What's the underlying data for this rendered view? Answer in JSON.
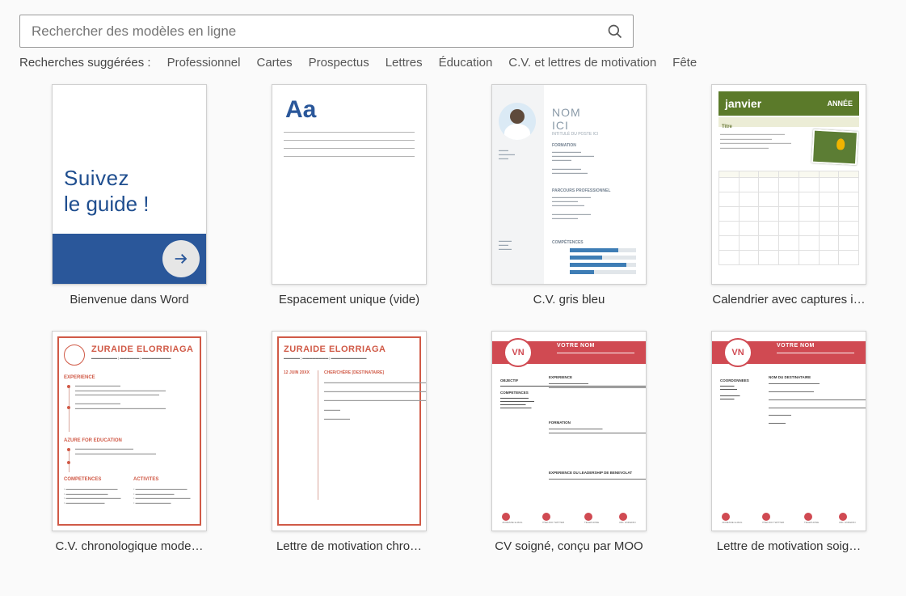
{
  "search": {
    "placeholder": "Rechercher des modèles en ligne"
  },
  "suggestions": {
    "label": "Recherches suggérées :",
    "items": [
      "Professionnel",
      "Cartes",
      "Prospectus",
      "Lettres",
      "Éducation",
      "C.V. et lettres de motivation",
      "Fête"
    ]
  },
  "templates": [
    {
      "caption": "Bienvenue dans Word",
      "content": {
        "line1": "Suivez",
        "line2": "le guide !"
      }
    },
    {
      "caption": "Espacement unique (vide)",
      "content": {
        "aa": "Aa"
      }
    },
    {
      "caption": "C.V. gris bleu",
      "content": {
        "name1": "NOM",
        "name2": "ICI"
      }
    },
    {
      "caption": "Calendrier avec captures i…",
      "content": {
        "month": "janvier",
        "year": "ANNÉE",
        "subtitle": "Titre"
      }
    },
    {
      "caption": "C.V. chronologique mode…",
      "content": {
        "name": "ZURAIDE ELORRIAGA",
        "sec1": "EXPERIENCE",
        "sec2": "AZURE FOR EDUCATION",
        "sec3": "COMPETENCES",
        "sec4": "ACTIVITES"
      }
    },
    {
      "caption": "Lettre de motivation chro…",
      "content": {
        "name": "ZURAIDE ELORRIAGA",
        "date": "12 JUIN 20XX",
        "recip": "CHER/CHÈRE [DESTINATAIRE]"
      }
    },
    {
      "caption": "CV soigné, conçu par MOO",
      "content": {
        "initials": "VN",
        "name": "VOTRE NOM",
        "s1": "OBJECTIF",
        "s2": "COMPETENCES",
        "s3": "EXPERIENCE",
        "s4": "FORMATION",
        "s5": "EXPERIENCE DU LEADERSHIP DE BENEVOLAT",
        "i1": "ADRESSE E-MAIL",
        "i2": "PSEUDO TWITTER",
        "i3": "TELEPHONE",
        "i4": "URL LINKEDIN"
      }
    },
    {
      "caption": "Lettre de motivation soig…",
      "content": {
        "initials": "VN",
        "name": "VOTRE NOM",
        "s1": "COORDONNEES",
        "s2": "NOM DU DESTINATAIRE",
        "i1": "ADRESSE E-MAIL",
        "i2": "PSEUDO TWITTER",
        "i3": "TELEPHONE",
        "i4": "URL LINKEDIN"
      }
    }
  ]
}
